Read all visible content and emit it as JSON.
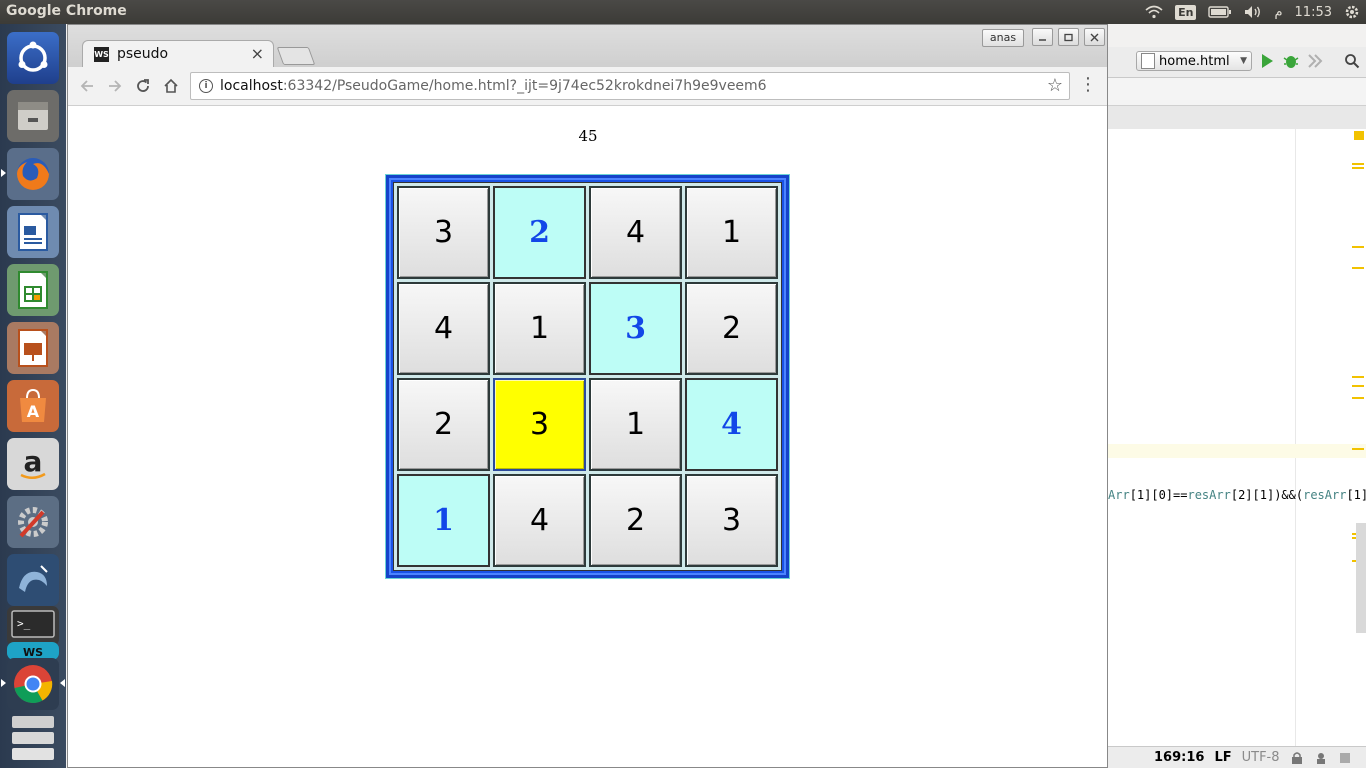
{
  "topbar": {
    "app_title": "Google Chrome",
    "lang": "En",
    "rtl_char": "م",
    "time": "11:53"
  },
  "launcher": {
    "items": [
      "ubuntu-dash",
      "files",
      "firefox",
      "writer",
      "calc",
      "impress",
      "software-center",
      "amazon",
      "system-settings",
      "mysql-workbench",
      "terminal",
      "webstorm",
      "chrome",
      "workspaces"
    ]
  },
  "chrome": {
    "tab_title": "pseudo",
    "favicon_text": "WS",
    "user_name": "anas",
    "url_host": "localhost",
    "url_rest": ":63342/PseudoGame/home.html?_ijt=9j74ec52krokdnei7h9e9veem6"
  },
  "game": {
    "score": "45",
    "grid": [
      [
        {
          "v": "3",
          "type": "user"
        },
        {
          "v": "2",
          "type": "given"
        },
        {
          "v": "4",
          "type": "user"
        },
        {
          "v": "1",
          "type": "user"
        }
      ],
      [
        {
          "v": "4",
          "type": "user"
        },
        {
          "v": "1",
          "type": "user"
        },
        {
          "v": "3",
          "type": "given"
        },
        {
          "v": "2",
          "type": "user"
        }
      ],
      [
        {
          "v": "2",
          "type": "user"
        },
        {
          "v": "3",
          "type": "selected"
        },
        {
          "v": "1",
          "type": "user"
        },
        {
          "v": "4",
          "type": "given"
        }
      ],
      [
        {
          "v": "1",
          "type": "given"
        },
        {
          "v": "4",
          "type": "user"
        },
        {
          "v": "2",
          "type": "user"
        },
        {
          "v": "3",
          "type": "user"
        }
      ]
    ]
  },
  "ide": {
    "file_name": "home.html",
    "code_line": "Arr[1][0]==resArr[2][1])&&(resArr[1][",
    "code_parts": [
      "Arr",
      "[1][0]==",
      "resArr",
      "[2][1])&&(",
      "resArr",
      "[1]["
    ],
    "cursor_pos": "169:16",
    "line_sep": "LF",
    "encoding": "UTF-8"
  },
  "colors": {
    "given_bg": "#bdfdf6",
    "given_text": "#1247e8",
    "selected_bg": "#ffff00",
    "board_border": "#1a52e6"
  }
}
